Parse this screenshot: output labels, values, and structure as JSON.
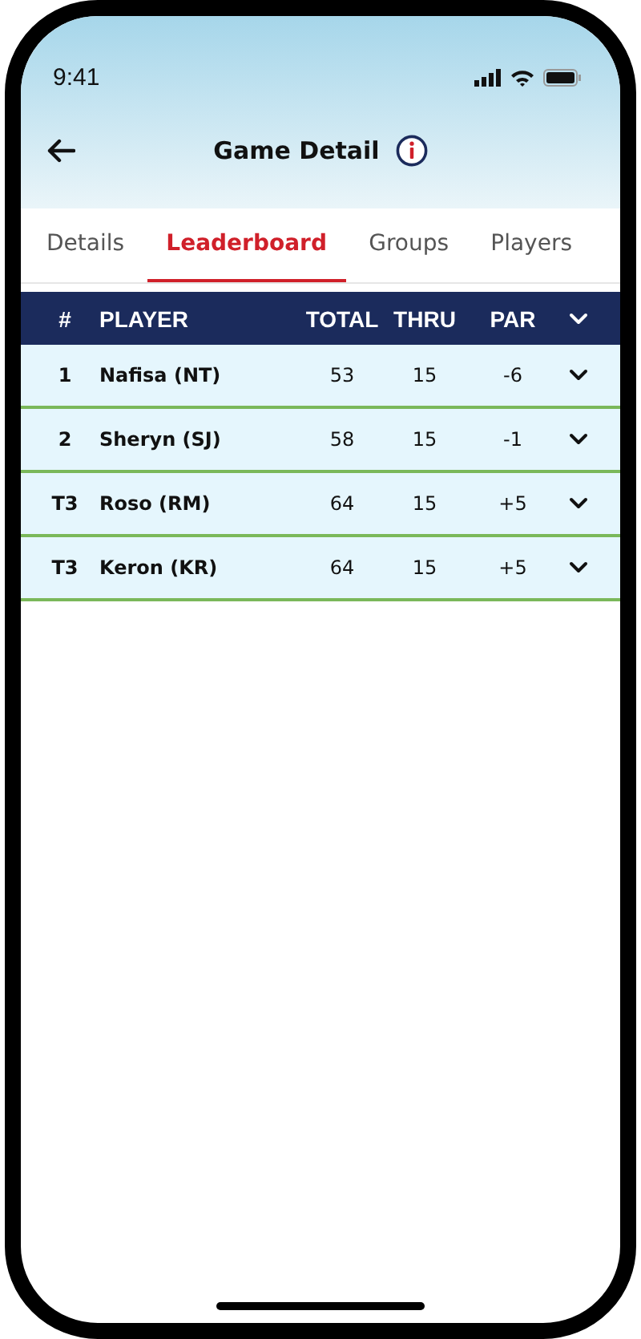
{
  "status_bar": {
    "time": "9:41"
  },
  "header": {
    "title": "Game Detail"
  },
  "tabs": [
    {
      "label": "Details",
      "selected": false
    },
    {
      "label": "Leaderboard",
      "selected": true
    },
    {
      "label": "Groups",
      "selected": false
    },
    {
      "label": "Players",
      "selected": false
    }
  ],
  "table": {
    "columns": [
      "#",
      "PLAYER",
      "TOTAL",
      "THRU",
      "PAR"
    ],
    "rows": [
      {
        "rank": "1",
        "player": "Nafisa (NT)",
        "total": "53",
        "thru": "15",
        "par": "-6",
        "expanded": false
      },
      {
        "rank": "2",
        "player": "Sheryn (SJ)",
        "total": "58",
        "thru": "15",
        "par": "-1",
        "expanded": false
      },
      {
        "rank": "T3",
        "player": "Roso (RM)",
        "total": "64",
        "thru": "15",
        "par": "+5",
        "expanded": false
      },
      {
        "rank": "T3",
        "player": "Keron (KR)",
        "total": "64",
        "thru": "15",
        "par": "+5",
        "expanded": false
      }
    ]
  }
}
